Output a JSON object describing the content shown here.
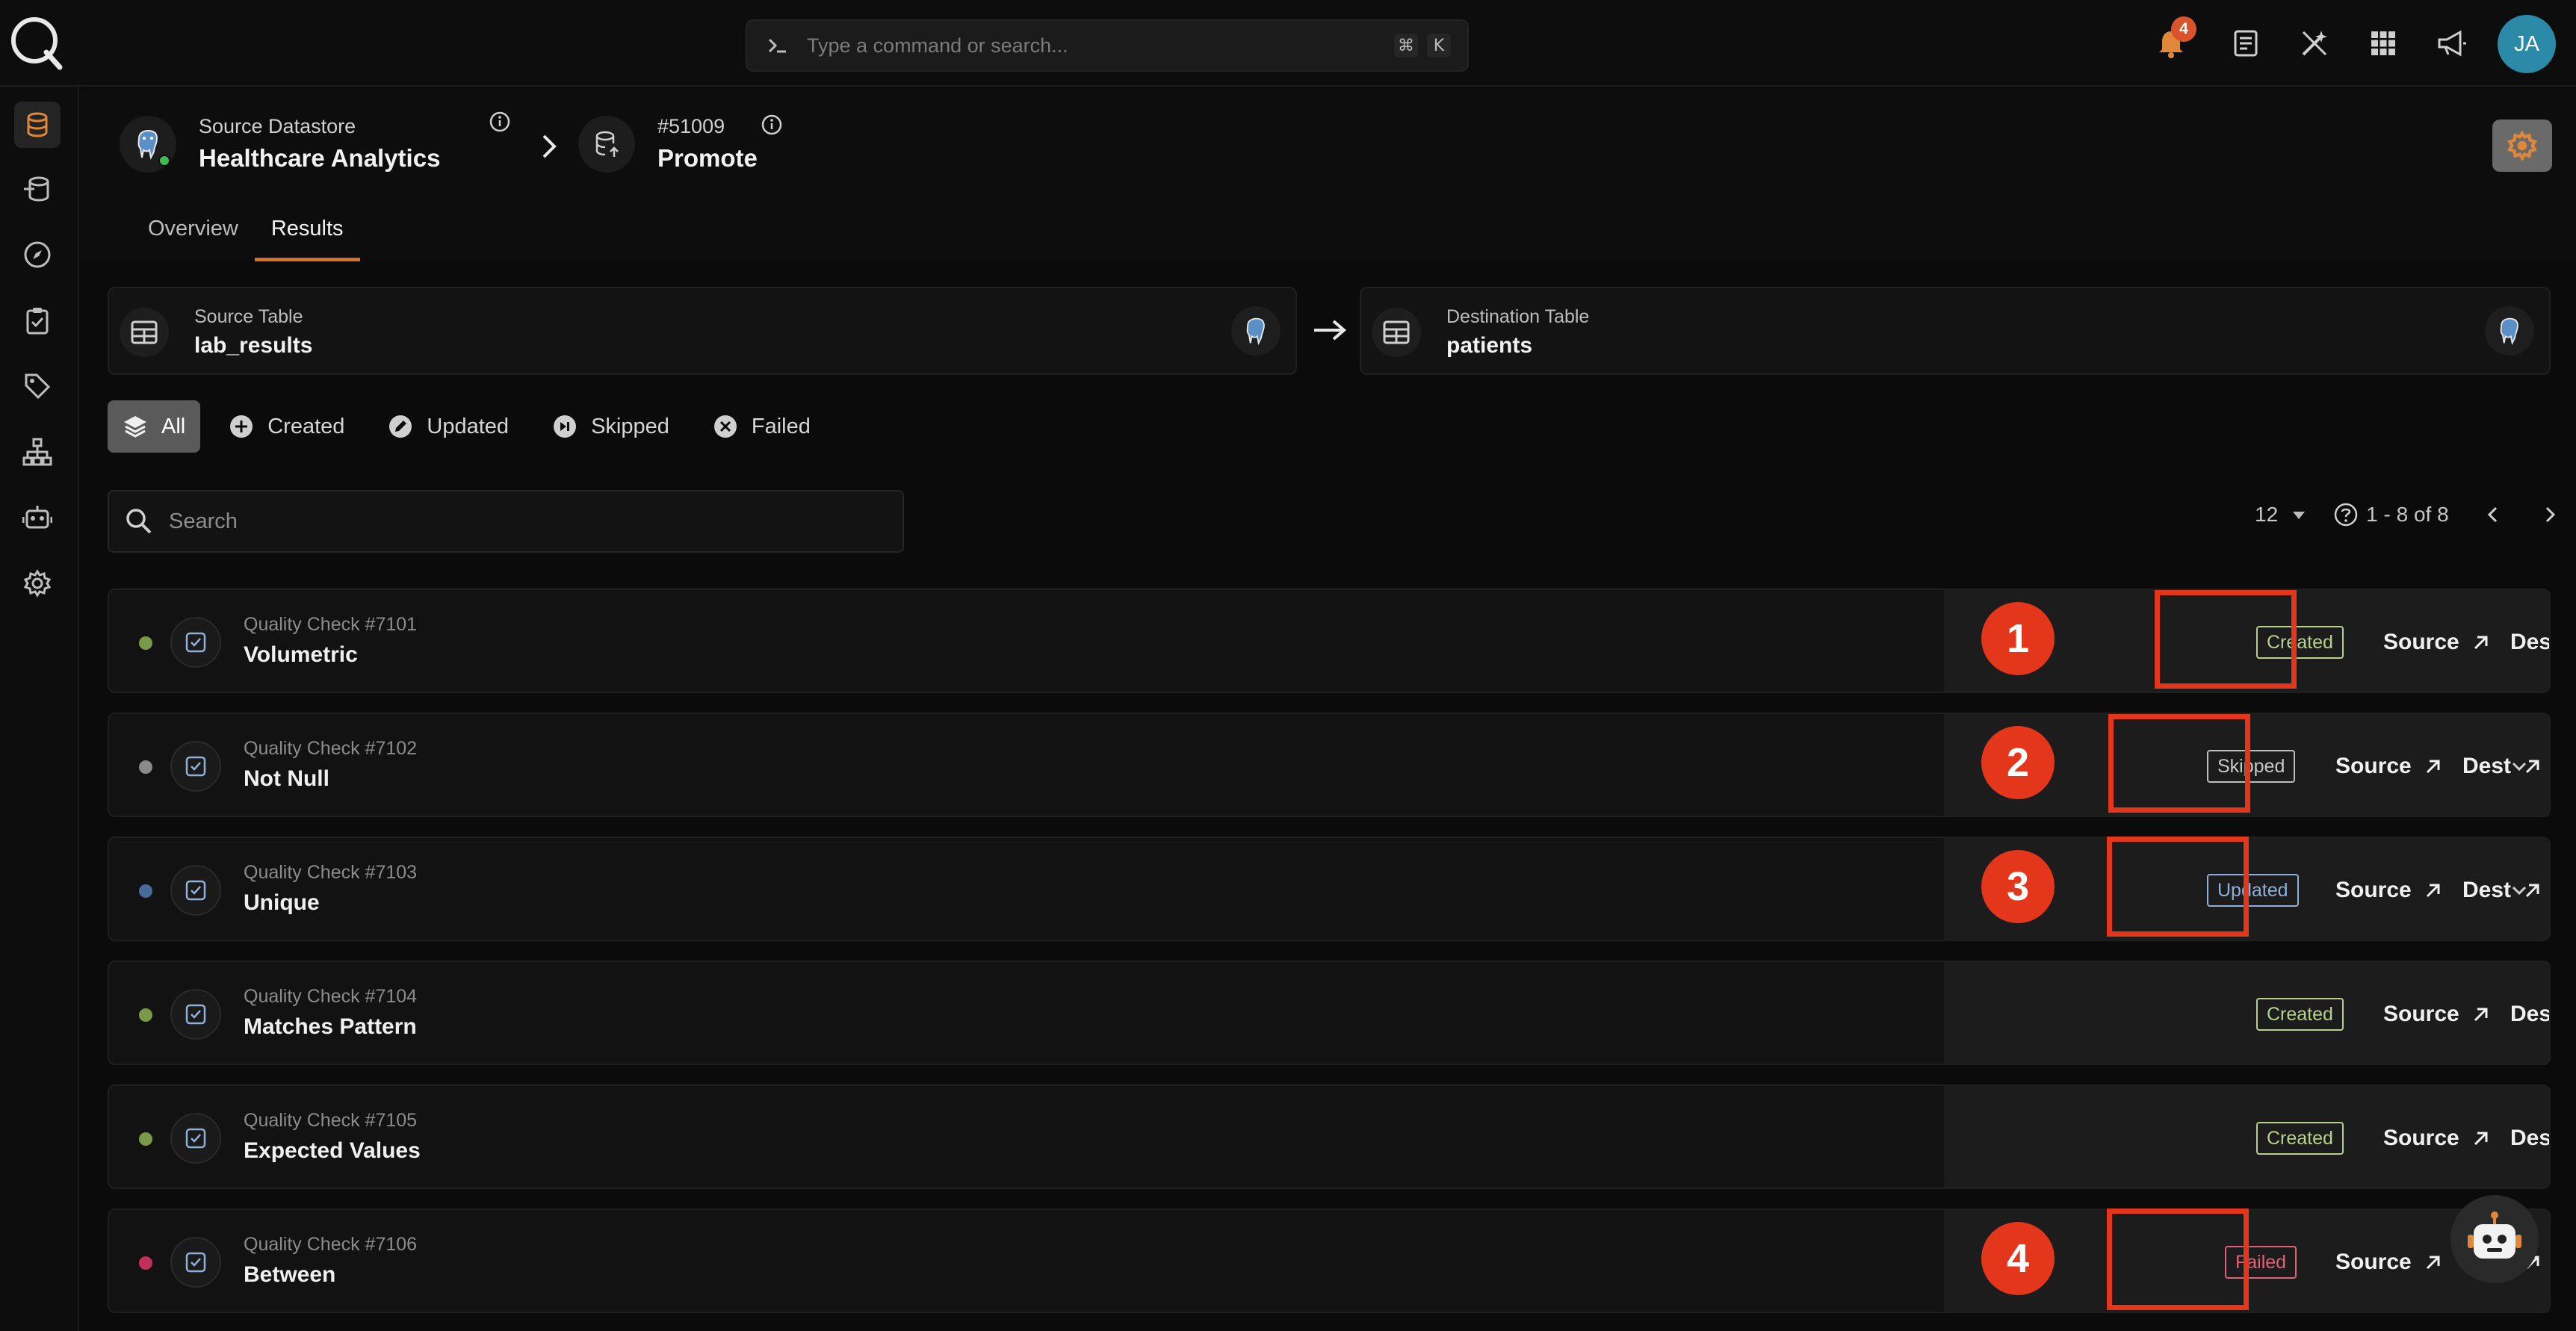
{
  "topbar": {
    "command_placeholder": "Type a command or search...",
    "kbd_cmd": "⌘",
    "kbd_key": "K",
    "notifications_count": "4",
    "avatar_initials": "JA"
  },
  "breadcrumb": {
    "datastore_label": "Source Datastore",
    "datastore_name": "Healthcare Analytics",
    "operation_id": "#51009",
    "operation_name": "Promote"
  },
  "tabs": [
    {
      "label": "Overview",
      "active": false
    },
    {
      "label": "Results",
      "active": true
    }
  ],
  "source_table": {
    "label": "Source Table",
    "name": "lab_results"
  },
  "destination_table": {
    "label": "Destination Table",
    "name": "patients"
  },
  "filters": [
    {
      "label": "All",
      "active": true
    },
    {
      "label": "Created",
      "active": false
    },
    {
      "label": "Updated",
      "active": false
    },
    {
      "label": "Skipped",
      "active": false
    },
    {
      "label": "Failed",
      "active": false
    }
  ],
  "search": {
    "placeholder": "Search"
  },
  "pagination": {
    "page_size": "12",
    "range": "1 - 8 of 8"
  },
  "links": {
    "source": "Source",
    "dest": "Dest"
  },
  "rows": [
    {
      "check_id": "Quality Check #7101",
      "name": "Volumetric",
      "status": "Created",
      "dot_color": "#7a9a4a",
      "expandable": false
    },
    {
      "check_id": "Quality Check #7102",
      "name": "Not Null",
      "status": "Skipped",
      "dot_color": "#8a8a8a",
      "expandable": true
    },
    {
      "check_id": "Quality Check #7103",
      "name": "Unique",
      "status": "Updated",
      "dot_color": "#4a6a9a",
      "expandable": true
    },
    {
      "check_id": "Quality Check #7104",
      "name": "Matches Pattern",
      "status": "Created",
      "dot_color": "#7a9a4a",
      "expandable": false
    },
    {
      "check_id": "Quality Check #7105",
      "name": "Expected Values",
      "status": "Created",
      "dot_color": "#7a9a4a",
      "expandable": false
    },
    {
      "check_id": "Quality Check #7106",
      "name": "Between",
      "status": "Failed",
      "dot_color": "#c0305a",
      "expandable": true
    }
  ],
  "markers": [
    "1",
    "2",
    "3",
    "4"
  ],
  "colors": {
    "accent": "#d9702b",
    "annotation": "#e4361b"
  }
}
